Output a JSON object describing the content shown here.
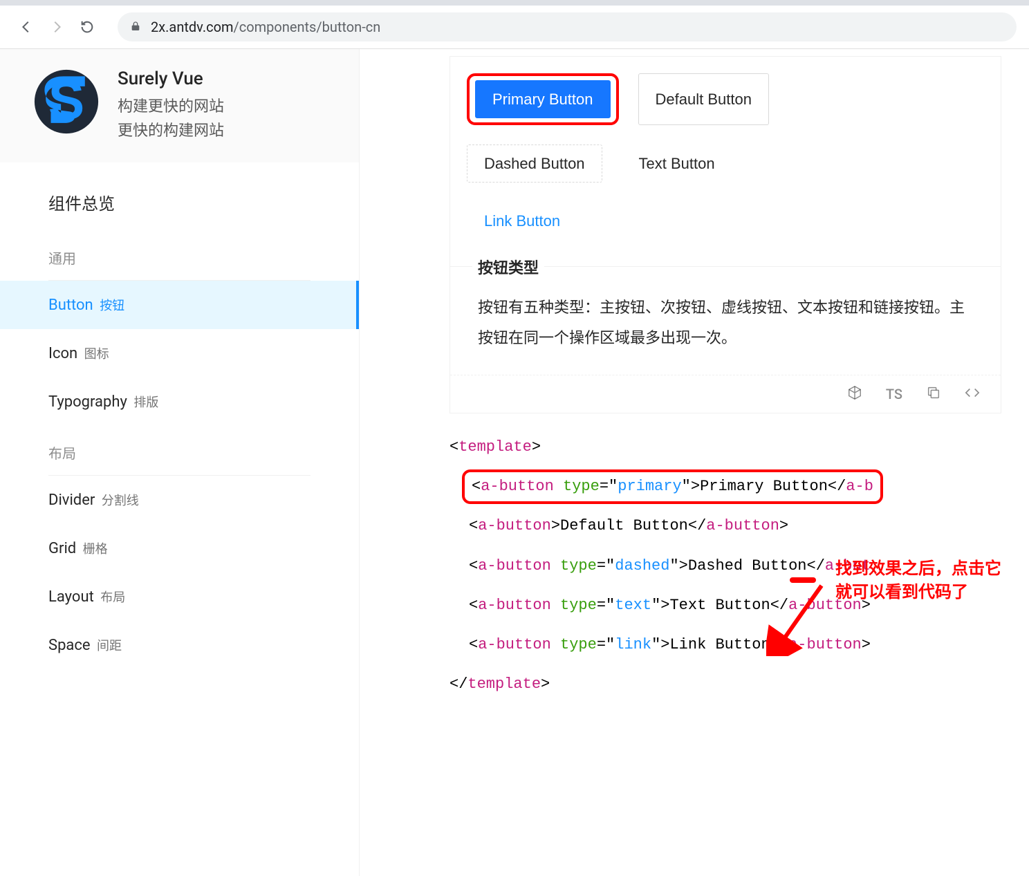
{
  "browser": {
    "url_domain": "2x.antdv.com",
    "url_path": "/components/button-cn"
  },
  "promo": {
    "title": "Surely Vue",
    "line1": "构建更快的网站",
    "line2": "更快的构建网站"
  },
  "sidebar": {
    "overview": "组件总览",
    "groups": [
      {
        "title": "通用",
        "items": [
          {
            "en": "Button",
            "cn": "按钮",
            "active": true
          },
          {
            "en": "Icon",
            "cn": "图标",
            "active": false
          },
          {
            "en": "Typography",
            "cn": "排版",
            "active": false
          }
        ]
      },
      {
        "title": "布局",
        "items": [
          {
            "en": "Divider",
            "cn": "分割线",
            "active": false
          },
          {
            "en": "Grid",
            "cn": "栅格",
            "active": false
          },
          {
            "en": "Layout",
            "cn": "布局",
            "active": false
          },
          {
            "en": "Space",
            "cn": "间距",
            "active": false
          }
        ]
      }
    ]
  },
  "demo": {
    "buttons": {
      "primary": "Primary Button",
      "default": "Default Button",
      "dashed": "Dashed Button",
      "text": "Text Button",
      "link": "Link Button"
    },
    "section_title": "按钮类型",
    "section_desc": "按钮有五种类型：主按钮、次按钮、虚线按钮、文本按钮和链接按钮。主按钮在同一个操作区域最多出现一次。",
    "actions": {
      "ts": "TS"
    }
  },
  "annotation": {
    "line1": "找到效果之后，点击它",
    "line2": "就可以看到代码了"
  },
  "code": {
    "template_open": "template",
    "template_close": "template",
    "lines": [
      {
        "tag": "a-button",
        "attr": "type",
        "val": "primary",
        "text": "Primary Button",
        "close": "a-b",
        "highlight": true,
        "cut": true
      },
      {
        "tag": "a-button",
        "attr": null,
        "val": null,
        "text": "Default Button",
        "close": "a-button",
        "highlight": false
      },
      {
        "tag": "a-button",
        "attr": "type",
        "val": "dashed",
        "text": "Dashed Button",
        "close": "a-but",
        "highlight": false,
        "cut": true
      },
      {
        "tag": "a-button",
        "attr": "type",
        "val": "text",
        "text": "Text Button",
        "close": "a-button",
        "highlight": false,
        "cut": true,
        "trail": ">"
      },
      {
        "tag": "a-button",
        "attr": "type",
        "val": "link",
        "text": "Link Button",
        "close": "a-button",
        "highlight": false,
        "cut": true,
        "trail": ">"
      }
    ]
  }
}
